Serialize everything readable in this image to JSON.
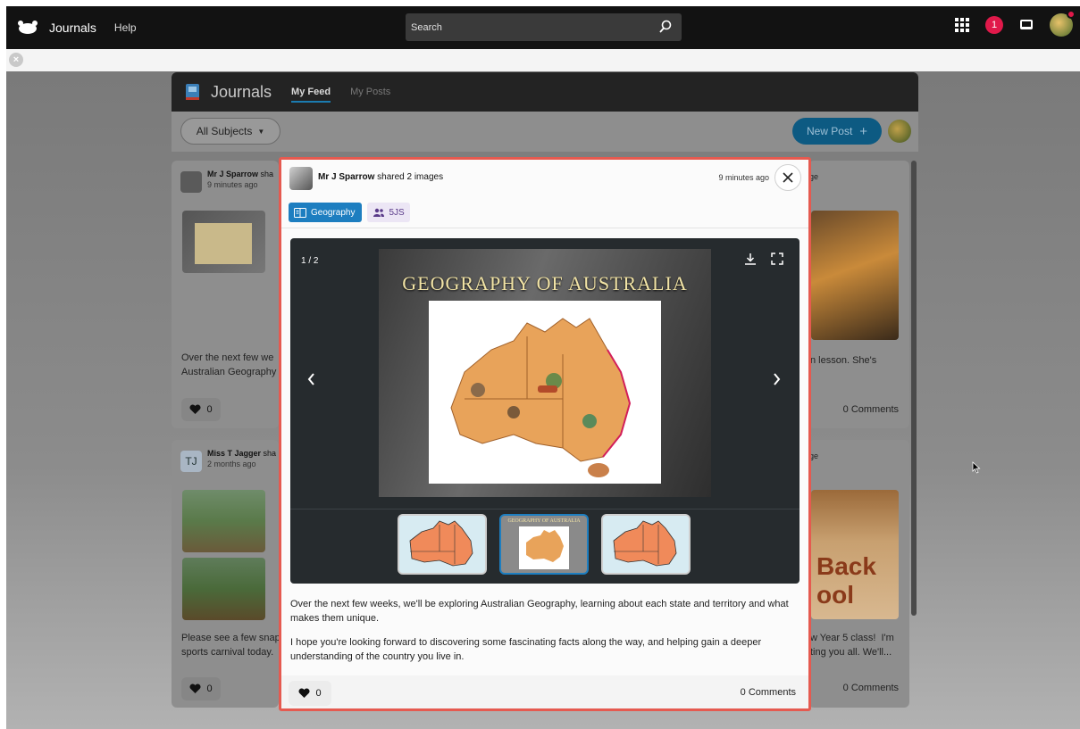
{
  "topbar": {
    "app_name": "Journals",
    "help": "Help",
    "search_placeholder": "Search",
    "notification_count": "1"
  },
  "journals": {
    "title": "Journals",
    "tabs": [
      {
        "label": "My Feed",
        "active": true
      },
      {
        "label": "My Posts",
        "active": false
      }
    ],
    "subject_filter": "All Subjects",
    "new_post": "New Post"
  },
  "background_cards": [
    {
      "author": "Mr J Sparrow",
      "action_fragment": "sha",
      "time": "9 minutes ago",
      "text": "Over the next few we\nAustralian Geography",
      "likes": "0"
    },
    {
      "action_fragment": "age",
      "text": "n lesson. She's",
      "comments": "0 Comments"
    },
    {
      "author": "Miss T Jagger",
      "initials": "TJ",
      "action_fragment": "sha",
      "time": "2 months ago",
      "text": "Please see a few snap\nsports carnival today.",
      "likes": "0"
    },
    {
      "action_fragment": "age",
      "text": "w Year 5 class!  I'm\nting you all. We'll...",
      "comments": "0 Comments",
      "image_text": "Back\nool"
    }
  ],
  "modal": {
    "author": "Mr J Sparrow",
    "action": "shared 2 images",
    "time": "9 minutes ago",
    "subject_tag": "Geography",
    "class_tag": "5JS",
    "counter": "1 / 2",
    "slide_title": "GEOGRAPHY OF AUSTRALIA",
    "thumb_caption": "GEOGRAPHY OF AUSTRALIA",
    "paragraph1": "Over the next few weeks, we'll be exploring Australian Geography, learning about each state and territory and what makes them unique.",
    "paragraph2": "I hope you're looking forward to discovering some fascinating facts along the way, and helping gain a deeper understanding of the country you live in.",
    "likes": "0",
    "comments": "0 Comments"
  },
  "colors": {
    "accent": "#1d7ec0",
    "badge": "#e0194a",
    "modal_border": "#e55a50"
  }
}
